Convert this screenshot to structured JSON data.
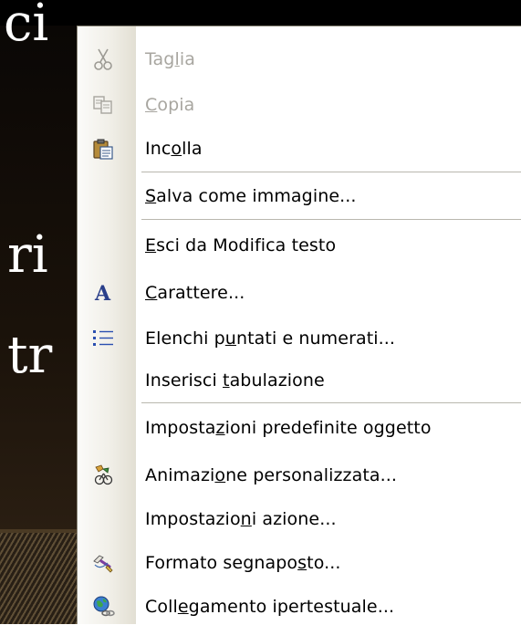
{
  "slide": {
    "text_lines": [
      "ci",
      "ri",
      "tr"
    ]
  },
  "menu": {
    "items": [
      {
        "id": "cut",
        "icon": "scissors-icon",
        "enabled": false,
        "pre": "Tag",
        "key": "l",
        "post": "ia"
      },
      {
        "id": "copy",
        "icon": "copy-icon",
        "enabled": false,
        "pre": "",
        "key": "C",
        "post": "opia"
      },
      {
        "id": "paste",
        "icon": "clipboard-paste-icon",
        "enabled": true,
        "pre": "Inc",
        "key": "o",
        "post": "lla"
      },
      {
        "id": "save-as-picture",
        "icon": "",
        "enabled": true,
        "pre": "",
        "key": "S",
        "post": "alva come immagine..."
      },
      {
        "id": "exit-text-edit",
        "icon": "",
        "enabled": true,
        "pre": "",
        "key": "E",
        "post": "sci da Modifica testo"
      },
      {
        "id": "font",
        "icon": "font-a-icon",
        "enabled": true,
        "pre": "",
        "key": "C",
        "post": "arattere..."
      },
      {
        "id": "bullets-numbering",
        "icon": "bullet-list-icon",
        "enabled": true,
        "pre": "Elenchi p",
        "key": "u",
        "post": "ntati e numerati..."
      },
      {
        "id": "insert-tab",
        "icon": "",
        "enabled": true,
        "pre": "Inserisci ",
        "key": "t",
        "post": "abulazione"
      },
      {
        "id": "object-defaults",
        "icon": "",
        "enabled": true,
        "pre": "Imposta",
        "key": "z",
        "post": "ioni predefinite oggetto"
      },
      {
        "id": "custom-animation",
        "icon": "custom-animation-icon",
        "enabled": true,
        "pre": "Animazi",
        "key": "o",
        "post": "ne personalizzata..."
      },
      {
        "id": "action-settings",
        "icon": "",
        "enabled": true,
        "pre": "Impostazio",
        "key": "n",
        "post": "i azione..."
      },
      {
        "id": "format-placeholder",
        "icon": "format-brush-icon",
        "enabled": true,
        "pre": "Formato segnapo",
        "key": "s",
        "post": "to..."
      },
      {
        "id": "hyperlink",
        "icon": "globe-link-icon",
        "enabled": true,
        "pre": "Coll",
        "key": "e",
        "post": "gamento ipertestuale..."
      }
    ]
  },
  "colors": {
    "disabled_text": "#a8a6a0",
    "menu_background": "#ffffff",
    "gutter": "#ecebe5",
    "separator": "#b9b7ae"
  }
}
